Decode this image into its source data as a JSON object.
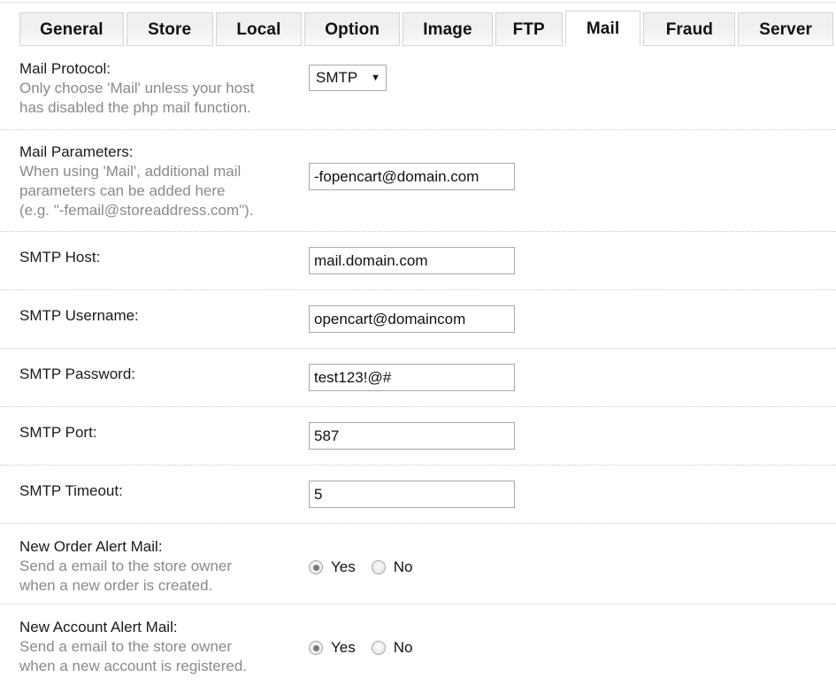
{
  "tabs": [
    {
      "label": "General",
      "active": false
    },
    {
      "label": "Store",
      "active": false
    },
    {
      "label": "Local",
      "active": false
    },
    {
      "label": "Option",
      "active": false
    },
    {
      "label": "Image",
      "active": false
    },
    {
      "label": "FTP",
      "active": false
    },
    {
      "label": "Mail",
      "active": true
    },
    {
      "label": "Fraud",
      "active": false
    },
    {
      "label": "Server",
      "active": false
    }
  ],
  "rows": {
    "mail_protocol": {
      "title": "Mail Protocol:",
      "desc_line1": "Only choose 'Mail' unless your host",
      "desc_line2": "has disabled the php mail function.",
      "select_value": "SMTP",
      "select_arrow": "▼"
    },
    "mail_parameters": {
      "title": "Mail Parameters:",
      "desc_line1": "When using 'Mail', additional mail",
      "desc_line2": "parameters can be added here",
      "desc_line3": "(e.g. \"-femail@storeaddress.com\").",
      "value": "-fopencart@domain.com"
    },
    "smtp_host": {
      "title": "SMTP Host:",
      "value": "mail.domain.com"
    },
    "smtp_username": {
      "title": "SMTP Username:",
      "value": "opencart@domaincom"
    },
    "smtp_password": {
      "title": "SMTP Password:",
      "value": "test123!@#"
    },
    "smtp_port": {
      "title": "SMTP Port:",
      "value": "587"
    },
    "smtp_timeout": {
      "title": "SMTP Timeout:",
      "value": "5"
    },
    "new_order_alert": {
      "title": "New Order Alert Mail:",
      "desc_line1": "Send a email to the store owner",
      "desc_line2": "when a new order is created.",
      "yes_label": "Yes",
      "no_label": "No",
      "selected": "Yes"
    },
    "new_account_alert": {
      "title": "New Account Alert Mail:",
      "desc_line1": "Send a email to the store owner",
      "desc_line2": "when a new account is registered.",
      "yes_label": "Yes",
      "no_label": "No",
      "selected": "Yes"
    }
  },
  "colors": {
    "label_text": "#1a1a1a",
    "description_text": "#8a8a8a",
    "input_border": "#a8a8a8",
    "separator": "#c9c9c9",
    "tab_border": "#d4d4d4",
    "radio_dot": "#7a7a7a"
  }
}
